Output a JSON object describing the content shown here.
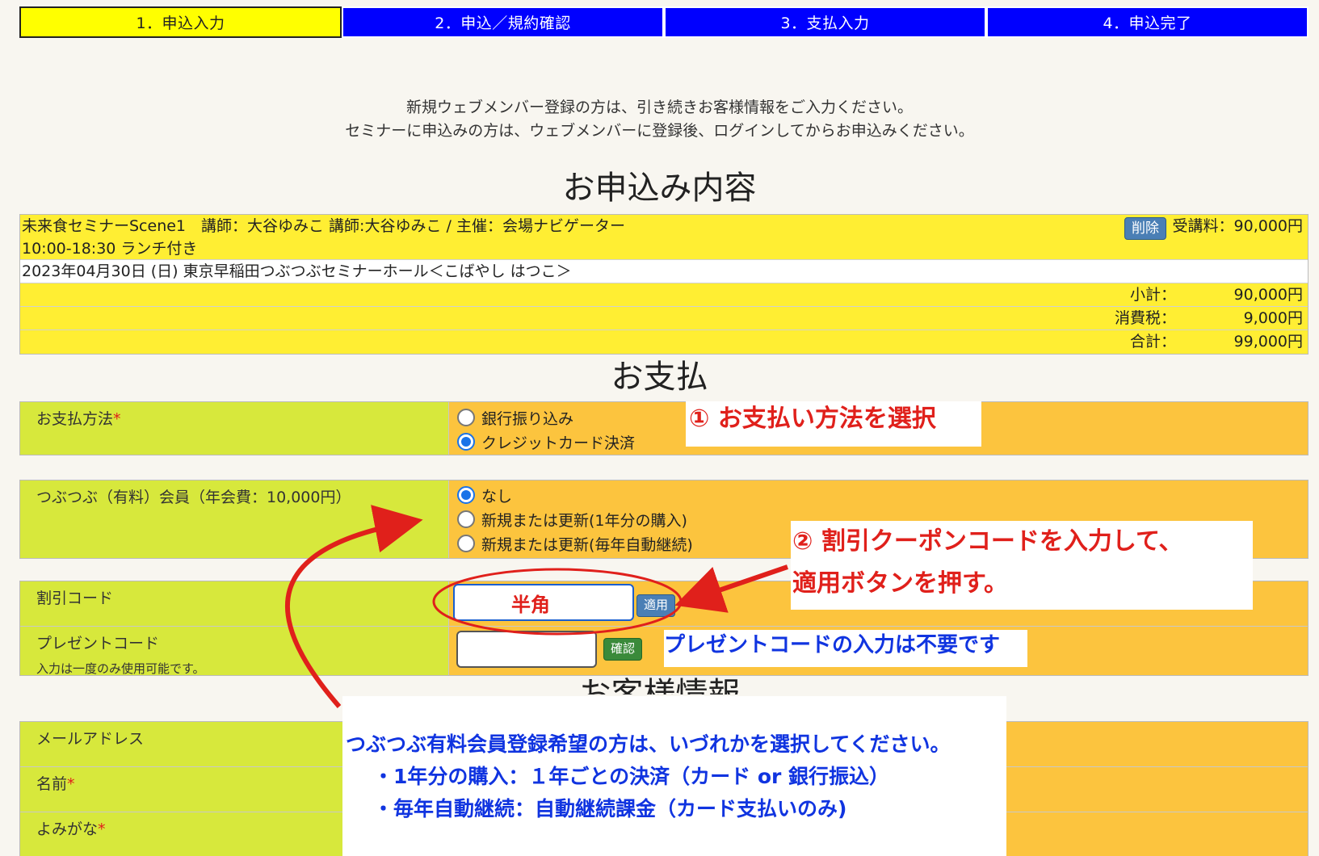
{
  "steps": [
    {
      "label": "1．申込入力",
      "state": "active"
    },
    {
      "label": "2．申込／規約確認",
      "state": "inactive"
    },
    {
      "label": "3．支払入力",
      "state": "inactive"
    },
    {
      "label": "4．申込完了",
      "state": "inactive"
    }
  ],
  "notice": {
    "line1": "新規ウェブメンバー登録の方は、引き続きお客様情報をご入力ください。",
    "line2": "セミナーに申込みの方は、ウェブメンバーに登録後、ログインしてからお申込みください。"
  },
  "order": {
    "title": "お申込み内容",
    "line1": "未来食セミナーScene1　講師：大谷ゆみこ 講師:大谷ゆみこ / 主催：会場ナビゲーター",
    "line2": "10:00-18:30 ランチ付き",
    "line3": "2023年04月30日 (日) 東京早稲田つぶつぶセミナーホール＜こばやし はつこ＞",
    "delete_label": "削除",
    "fee": "受講料：90,000円",
    "subtotal_label": "小計：",
    "subtotal": "90,000円",
    "tax_label": "消費税：",
    "tax": "9,000円",
    "total_label": "合計：",
    "total": "99,000円"
  },
  "payment": {
    "title": "お支払",
    "method_label": "お支払方法",
    "required_mark": "*",
    "options": [
      "銀行振り込み",
      "クレジットカード決済"
    ],
    "selected": 1
  },
  "membership": {
    "label": "つぶつぶ（有料）会員（年会費：10,000円）",
    "options": [
      "なし",
      "新規または更新(1年分の購入)",
      "新規または更新(毎年自動継続)"
    ],
    "selected": 0
  },
  "discount": {
    "label": "割引コード",
    "placeholder_note": "半角",
    "apply_label": "適用"
  },
  "present": {
    "label": "プレゼントコード",
    "sub": "入力は一度のみ使用可能です。",
    "confirm_label": "確認"
  },
  "customer": {
    "title_partial": "お客様情報",
    "email_label": "メールアドレス",
    "name_label": "名前",
    "kana_label": "よみがな"
  },
  "annotations": {
    "step1": "① お支払い方法を選択",
    "step2_line1": "② 割引クーポンコードを入力して、",
    "step2_line2": "適用ボタンを押す。",
    "present_note": "プレゼントコードの入力は不要です",
    "member_line1": "つぶつぶ有料会員登録希望の方は、いづれかを選択してください。",
    "member_line2": "・1年分の購入：１年ごとの決済（カード or 銀行振込）",
    "member_line3": "・毎年自動継続：自動継続課金（カード支払いのみ)"
  },
  "colors": {
    "step_active": "#ffff00",
    "step_inactive": "#0000ff",
    "label_bg": "#d7e83c",
    "field_bg": "#fcc43e",
    "order_yellow": "#ffee33",
    "annotation_red": "#e0201b",
    "annotation_blue": "#1034e0"
  }
}
